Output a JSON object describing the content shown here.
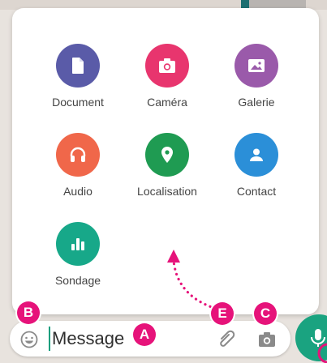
{
  "attachments": [
    {
      "label": "Document",
      "color": "#5a5ba8",
      "icon": "document-icon"
    },
    {
      "label": "Caméra",
      "color": "#e8356e",
      "icon": "camera-icon"
    },
    {
      "label": "Galerie",
      "color": "#9a5aaa",
      "icon": "gallery-icon"
    },
    {
      "label": "Audio",
      "color": "#f0674a",
      "icon": "headphones-icon"
    },
    {
      "label": "Localisation",
      "color": "#1f9b52",
      "icon": "location-pin-icon"
    },
    {
      "label": "Contact",
      "color": "#2b8fd8",
      "icon": "contact-person-icon"
    },
    {
      "label": "Sondage",
      "color": "#17a889",
      "icon": "poll-bars-icon"
    }
  ],
  "input": {
    "placeholder": "Message"
  },
  "badges": {
    "A": "A",
    "B": "B",
    "C": "C",
    "E": "E"
  },
  "colors": {
    "badge": "#e6137a",
    "mic_button": "#1aa380",
    "caret": "#0d9e7d"
  }
}
